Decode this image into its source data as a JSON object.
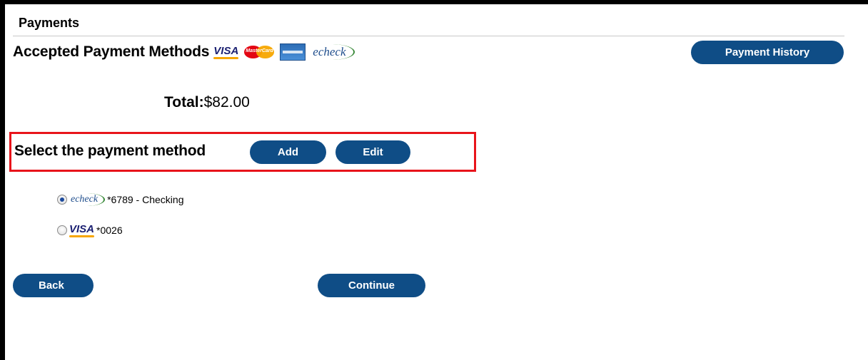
{
  "header": {
    "title": "Payments"
  },
  "accepted": {
    "label": "Accepted Payment Methods",
    "logos": {
      "visa": "VISA",
      "mastercard": "MasterCard",
      "amex": "American Express",
      "echeck": "echeck"
    }
  },
  "buttons": {
    "payment_history": "Payment History",
    "add": "Add",
    "edit": "Edit",
    "back": "Back",
    "continue": "Continue"
  },
  "total": {
    "label": "Total:",
    "value": "$82.00"
  },
  "select": {
    "label": "Select the payment method"
  },
  "methods": [
    {
      "logo": "echeck",
      "text": "*6789 - Checking",
      "selected": true
    },
    {
      "logo": "VISA",
      "text": "*0026",
      "selected": false
    }
  ],
  "colors": {
    "button_bg": "#0f4d86",
    "highlight_border": "#e8141b"
  }
}
